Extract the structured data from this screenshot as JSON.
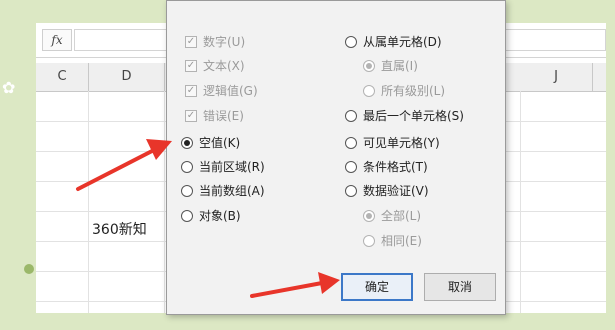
{
  "formula_bar": {
    "fx_label": "fx"
  },
  "columns": [
    "C",
    "D",
    "J"
  ],
  "cells": {
    "d_note": "360新知"
  },
  "dialog": {
    "left_options": [
      {
        "label": "数字(U)",
        "type": "check",
        "checked": true,
        "disabled": true
      },
      {
        "label": "文本(X)",
        "type": "check",
        "checked": true,
        "disabled": true
      },
      {
        "label": "逻辑值(G)",
        "type": "check",
        "checked": true,
        "disabled": true
      },
      {
        "label": "错误(E)",
        "type": "check",
        "checked": true,
        "disabled": true
      },
      {
        "label": "空值(K)",
        "type": "radio",
        "checked": true,
        "disabled": false
      },
      {
        "label": "当前区域(R)",
        "type": "radio",
        "checked": false,
        "disabled": false
      },
      {
        "label": "当前数组(A)",
        "type": "radio",
        "checked": false,
        "disabled": false
      },
      {
        "label": "对象(B)",
        "type": "radio",
        "checked": false,
        "disabled": false
      }
    ],
    "right_options": [
      {
        "label": "从属单元格(D)",
        "type": "radio",
        "checked": false,
        "disabled": false
      },
      {
        "label": "直属(I)",
        "type": "radio",
        "checked": true,
        "disabled": true
      },
      {
        "label": "所有级别(L)",
        "type": "radio",
        "checked": false,
        "disabled": true
      },
      {
        "label": "最后一个单元格(S)",
        "type": "radio",
        "checked": false,
        "disabled": false
      },
      {
        "label": "可见单元格(Y)",
        "type": "radio",
        "checked": false,
        "disabled": false
      },
      {
        "label": "条件格式(T)",
        "type": "radio",
        "checked": false,
        "disabled": false
      },
      {
        "label": "数据验证(V)",
        "type": "radio",
        "checked": false,
        "disabled": false
      },
      {
        "label": "全部(L)",
        "type": "radio",
        "checked": true,
        "disabled": true
      },
      {
        "label": "相同(E)",
        "type": "radio",
        "checked": false,
        "disabled": true
      }
    ],
    "ok_label": "确定",
    "cancel_label": "取消"
  },
  "colors": {
    "background": "#dce8c4",
    "dialog": "#f2f2f2",
    "arrow": "#e8352a",
    "ok_border": "#3c78c8"
  }
}
